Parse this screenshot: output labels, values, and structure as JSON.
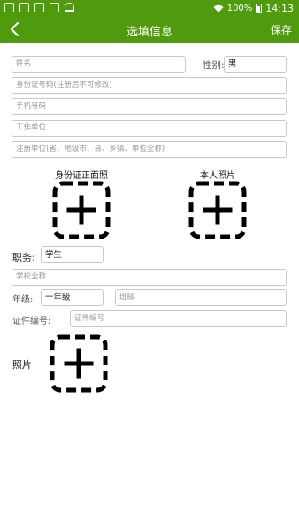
{
  "status_bar": {
    "battery": "100%",
    "time": "14:13"
  },
  "appbar": {
    "title": "选填信息",
    "save_label": "保存"
  },
  "form": {
    "name_placeholder": "姓名",
    "gender_label": "性别:",
    "gender_value": "男",
    "id_number_placeholder": "身份证号码(注册后不可修改)",
    "phone_placeholder": "手机号码",
    "work_unit_placeholder": "工作单位",
    "reg_unit_placeholder": "注册单位(省、地级市、县、乡镇、单位全称)",
    "id_photo_label": "身份证正面照",
    "self_photo_label": "本人照片",
    "position_label": "职务:",
    "position_value": "学生",
    "school_placeholder": "学校全称",
    "grade_label": "年级:",
    "grade_value": "一年级",
    "class_placeholder": "班级",
    "cert_label": "证件编号:",
    "cert_placeholder": "证件编号",
    "photo_label": "照片"
  },
  "colors": {
    "brand_green": "#4f9a0d"
  }
}
